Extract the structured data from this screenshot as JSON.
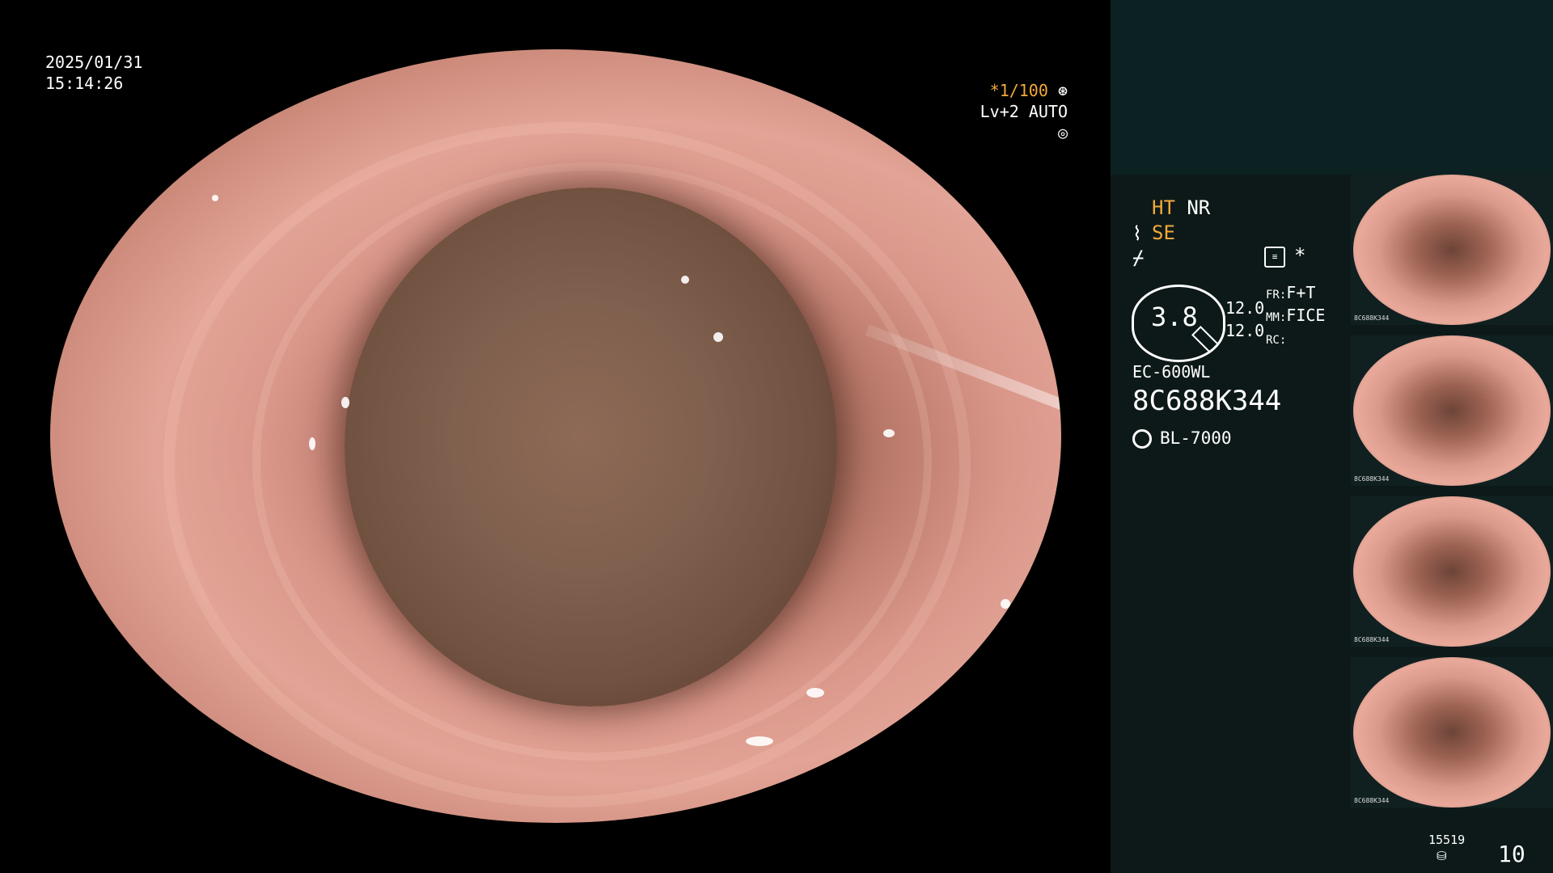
{
  "overlay": {
    "date": "2025/01/31",
    "time": "15:14:26",
    "shutter": "1/100",
    "level": "Lv+2 AUTO"
  },
  "sidebar": {
    "ht": "HT",
    "nr": "NR",
    "se": "SE",
    "zoom": "3.8",
    "val1": "12.0",
    "val2": "12.0",
    "fr_label": "FR:",
    "fr_val": "F+T",
    "mm_label": "MM:",
    "mm_val": "FICE",
    "rc_label": "RC:",
    "model": "EC-600WL",
    "serial": "8C688K344",
    "light": "BL-7000"
  },
  "thumbnails": [
    {
      "label": "8C688K344"
    },
    {
      "label": "8C688K344"
    },
    {
      "label": "8C688K344"
    },
    {
      "label": "8C688K344"
    }
  ],
  "footer": {
    "count": "15519",
    "number": "10"
  }
}
